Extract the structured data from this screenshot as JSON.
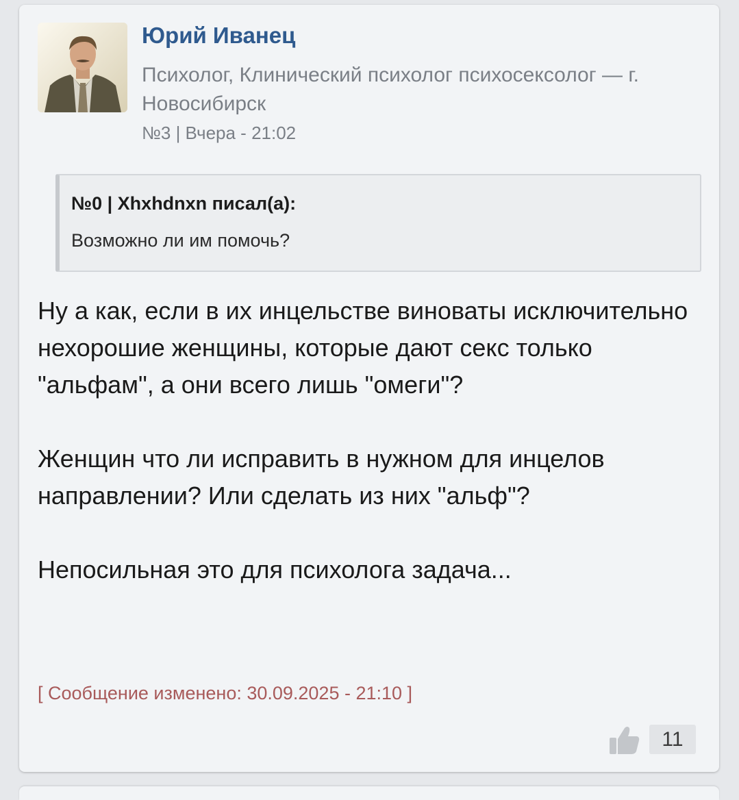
{
  "post": {
    "author_name": "Юрий Иванец",
    "author_description": "Психолог, Клинический психолог психосексолог — г. Новосибирск",
    "meta": "№3 | Вчера - 21:02",
    "quote": {
      "header": "№0 | Xhxhdnxn писал(а):",
      "text": "Возможно ли им помочь?"
    },
    "paragraphs": [
      "Ну а как, если в их инцельстве виноваты исключительно нехорошие женщины, которые дают секс только \"альфам\", а они всего лишь \"омеги\"?",
      "Женщин что ли исправить в нужном для инцелов направлении? Или сделать из них \"альф\"?",
      "Непосильная это для психолога задача..."
    ],
    "edited_note": "[ Сообщение изменено: 30.09.2025 - 21:10 ]",
    "likes": "11"
  },
  "icons": {
    "like": "thumbs-up-icon",
    "avatar": "author-avatar-photo"
  },
  "colors": {
    "author_name": "#2f5a8e",
    "edited_note": "#a85a5a",
    "card_background": "#f2f4f6"
  }
}
